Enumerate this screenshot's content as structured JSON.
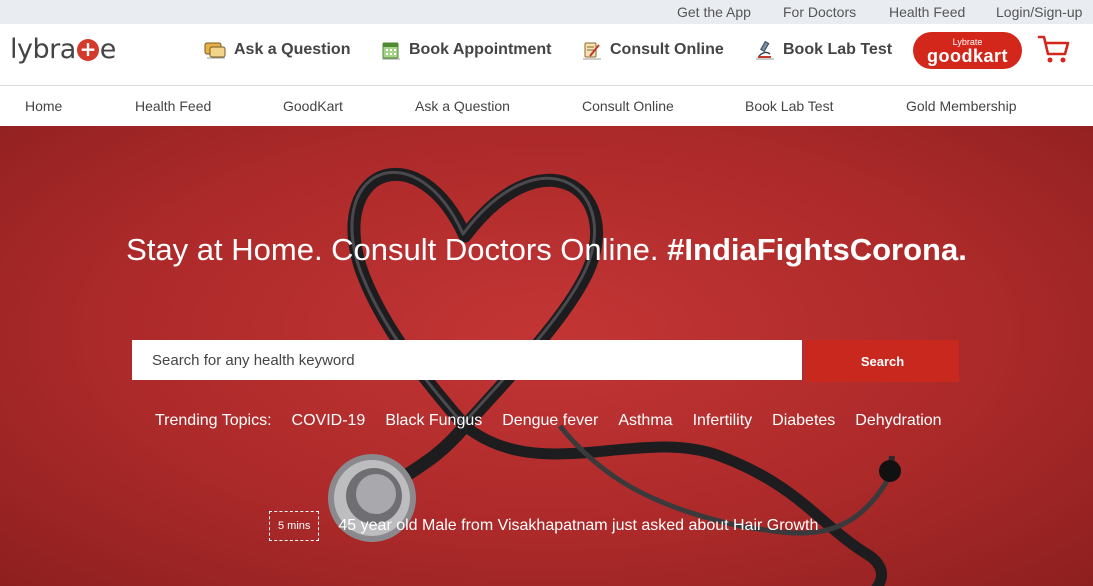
{
  "topbar": {
    "links": [
      "Get the App",
      "For Doctors",
      "Health Feed",
      "Login/Sign-up"
    ]
  },
  "brand": {
    "logo_before": "lybra",
    "logo_after": "e",
    "accent": "#d4271c"
  },
  "mainnav": {
    "ask": "Ask a Question",
    "book": "Book Appointment",
    "consult": "Consult Online",
    "lab": "Book Lab Test",
    "goodkart_small": "Lybrate",
    "goodkart_big": "goodkart"
  },
  "subnav": [
    "Home",
    "Health Feed",
    "GoodKart",
    "Ask a Question",
    "Consult Online",
    "Book Lab Test",
    "Gold Membership"
  ],
  "hero": {
    "headline": "Stay at Home. Consult Doctors Online.",
    "hashtag": "#IndiaFightsCorona.",
    "search_placeholder": "Search for any health keyword",
    "search_button": "Search",
    "trending_label": "Trending Topics:",
    "trending": [
      "COVID-19",
      "Black Fungus",
      "Dengue fever",
      "Asthma",
      "Infertility",
      "Diabetes",
      "Dehydration"
    ],
    "feed_time": "5 mins",
    "feed_message": "45 year old Male from Visakhapatnam just asked about Hair Growth"
  },
  "icons": {
    "ask": "chat-bubble-icon",
    "book": "calendar-icon",
    "consult": "clipboard-pen-icon",
    "lab": "microscope-icon",
    "cart": "cart-icon"
  }
}
